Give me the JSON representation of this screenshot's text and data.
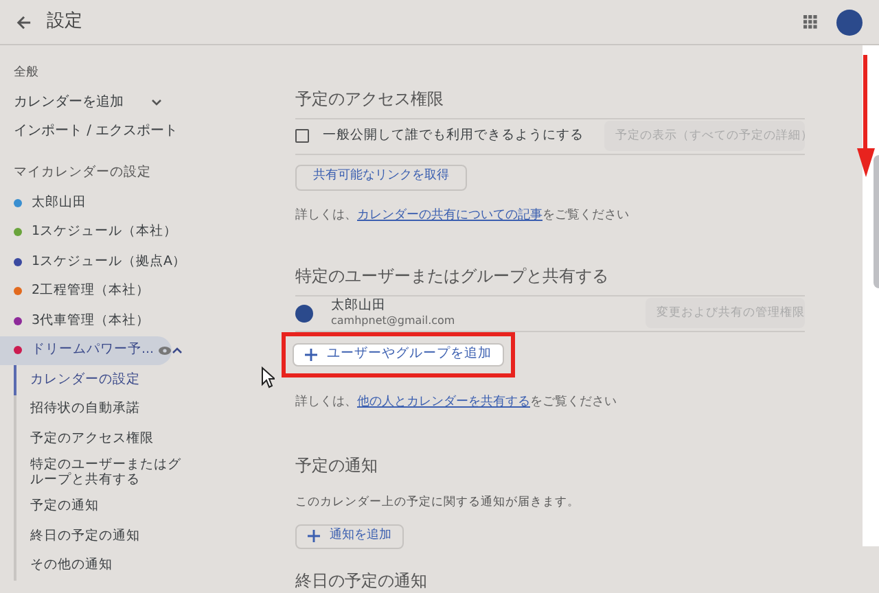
{
  "header": {
    "title": "設定"
  },
  "sidebar": {
    "general_label": "全般",
    "general_items": [
      {
        "label": "カレンダーを追加",
        "expanded": false
      },
      {
        "label": "インポート / エクスポート"
      }
    ],
    "my_calendars_label": "マイカレンダーの設定",
    "calendars": [
      {
        "name": "太郎山田",
        "color": "#3a8fd0",
        "selected": false
      },
      {
        "name": "1スケジュール（本社）",
        "color": "#6aa43c",
        "selected": false
      },
      {
        "name": "1スケジュール（拠点A）",
        "color": "#3b4aa0",
        "selected": false
      },
      {
        "name": "2工程管理（本社）",
        "color": "#e26a1e",
        "selected": false
      },
      {
        "name": "3代車管理（本社）",
        "color": "#8e2a9a",
        "selected": false
      },
      {
        "name": "ドリームパワー予...",
        "color": "#cc1c50",
        "selected": true,
        "expanded": true,
        "children": [
          {
            "label": "カレンダーの設定",
            "selected": true
          },
          {
            "label": "招待状の自動承諾",
            "selected": false
          },
          {
            "label": "予定のアクセス権限",
            "selected": false
          },
          {
            "label": "特定のユーザーまたはグループと共有する",
            "selected": false
          },
          {
            "label": "予定の通知",
            "selected": false
          },
          {
            "label": "終日の予定の通知",
            "selected": false
          },
          {
            "label": "その他の通知",
            "selected": false
          }
        ]
      }
    ]
  },
  "access": {
    "title": "予定のアクセス権限",
    "public_checkbox": {
      "label": "一般公開して誰でも利用できるようにする",
      "checked": false
    },
    "visibility_dropdown": {
      "value": "予定の表示（すべての予定の詳細）",
      "disabled": true
    },
    "link_button": "共有可能なリンクを取得",
    "help": {
      "prefix": "詳しくは、",
      "link": "カレンダーの共有についての記事",
      "suffix": "をご覧ください"
    }
  },
  "share": {
    "title": "特定のユーザーまたはグループと共有する",
    "users": [
      {
        "name": "太郎山田",
        "email": "camhpnet@gmail.com",
        "permission": "変更および共有の管理権限",
        "disabled": true
      }
    ],
    "add_button": {
      "label": "ユーザーやグループを追加",
      "highlighted": true
    },
    "help": {
      "prefix": "詳しくは、",
      "link": "他の人とカレンダーを共有する",
      "suffix": "をご覧ください"
    }
  },
  "notifications": {
    "title": "予定の通知",
    "description": "このカレンダー上の予定に関する通知が届きます。",
    "add_button": "通知を追加"
  },
  "all_day": {
    "title": "終日の予定の通知"
  }
}
